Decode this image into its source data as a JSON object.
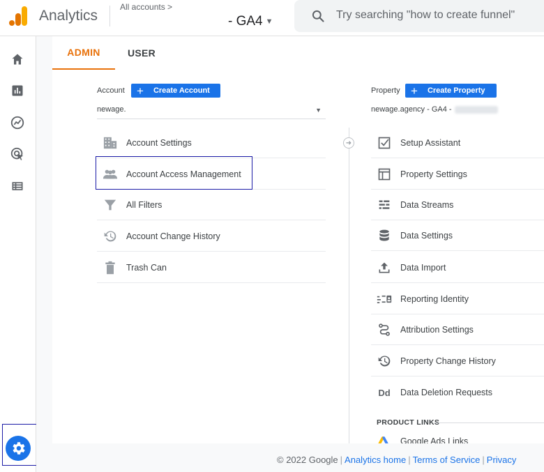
{
  "header": {
    "app_title": "Analytics",
    "breadcrumb": "All accounts >",
    "property_name": "- GA4",
    "search_placeholder": "Try searching \"how to create funnel\""
  },
  "tabs": [
    {
      "label": "ADMIN",
      "active": true
    },
    {
      "label": "USER",
      "active": false
    }
  ],
  "account_column": {
    "label": "Account",
    "create_label": "Create Account",
    "selected": "newage.",
    "items": [
      {
        "label": "Account Settings",
        "icon": "building-icon"
      },
      {
        "label": "Account Access Management",
        "icon": "people-icon",
        "highlighted": true
      },
      {
        "label": "All Filters",
        "icon": "filter-icon"
      },
      {
        "label": "Account Change History",
        "icon": "history-icon"
      },
      {
        "label": "Trash Can",
        "icon": "trash-icon"
      }
    ]
  },
  "property_column": {
    "label": "Property",
    "create_label": "Create Property",
    "selected": "newage.agency - GA4 -",
    "items": [
      {
        "label": "Setup Assistant",
        "icon": "checklist-icon"
      },
      {
        "label": "Property Settings",
        "icon": "layout-icon"
      },
      {
        "label": "Data Streams",
        "icon": "streams-icon"
      },
      {
        "label": "Data Settings",
        "icon": "database-icon"
      },
      {
        "label": "Data Import",
        "icon": "upload-icon"
      },
      {
        "label": "Reporting Identity",
        "icon": "identity-icon"
      },
      {
        "label": "Attribution Settings",
        "icon": "attribution-icon"
      },
      {
        "label": "Property Change History",
        "icon": "history-icon"
      },
      {
        "label": "Data Deletion Requests",
        "icon": "dd-icon"
      }
    ],
    "product_links_title": "PRODUCT LINKS",
    "product_links": [
      {
        "label": "Google Ads Links",
        "icon": "google-ads-icon"
      }
    ]
  },
  "footer": {
    "copyright": "© 2022 Google",
    "links": [
      "Analytics home",
      "Terms of Service",
      "Privacy"
    ]
  },
  "colors": {
    "accent": "#e8710a",
    "primary": "#1a73e8",
    "highlight_border": "#1a1aa6"
  }
}
